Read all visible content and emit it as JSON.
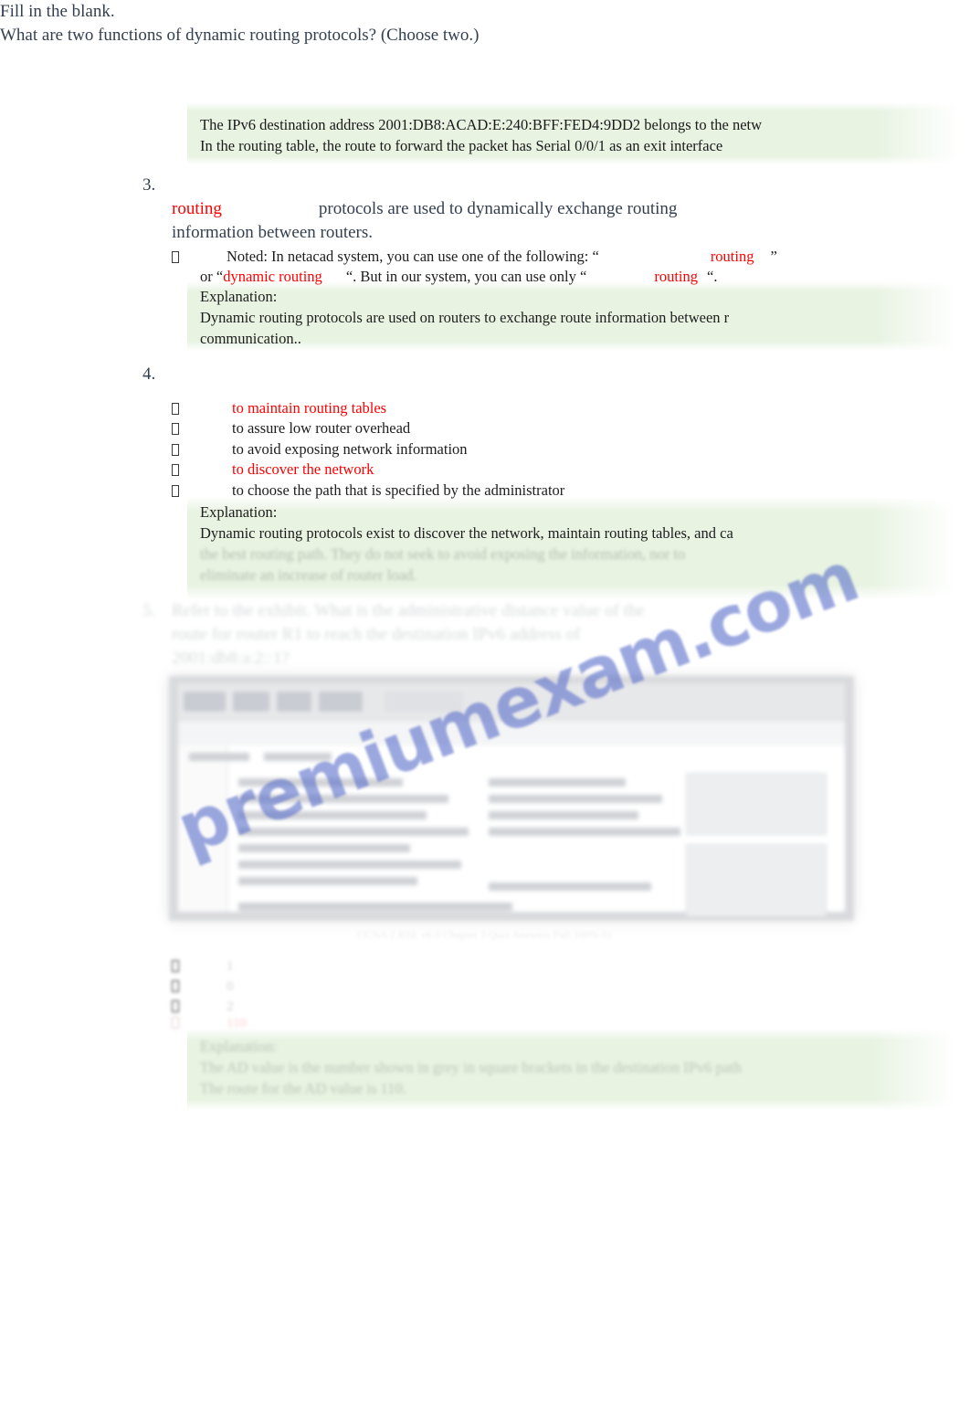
{
  "document": {
    "type": "exam-answer-key",
    "watermark": "premiumexam.com",
    "accent_red": "#ff0000",
    "highlight_green": "#e8f3e2",
    "heading_color": "#333f4f"
  },
  "top_block": {
    "lines": [
      "The IPv6 destination address 2001:DB8:ACAD:E:240:BFF:FED4:9DD2 belongs to the netw",
      "In the routing table, the route to forward the packet has Serial 0/0/1 as an exit interface"
    ]
  },
  "question3": {
    "number": "3.",
    "prompt": "Fill in the blank.",
    "answer_blank": "routing",
    "statement_part1": "protocols are used to dynamically exchange routing",
    "statement_part2": "information between routers.",
    "note": {
      "bullet": "tofu-box",
      "text_before": "Noted: In netacad system, you can use one of the following: “",
      "answer1": "routing",
      "text_mid1": "”",
      "text_or": "or “",
      "answer2": "dynamic routing",
      "text_mid2": "“. But in our system, you can use only “",
      "answer3": "routing",
      "text_end": "“."
    },
    "explanation": {
      "label": "Explanation:",
      "lines": [
        "Dynamic routing protocols are used on routers to exchange route information between r",
        "communication.."
      ]
    }
  },
  "question4": {
    "number": "4.",
    "prompt": "What are two functions of dynamic routing protocols? (Choose two.)",
    "options": [
      {
        "label": "to maintain routing tables",
        "correct": true
      },
      {
        "label": "to assure low router overhead",
        "correct": false
      },
      {
        "label": "to avoid exposing network information",
        "correct": false
      },
      {
        "label": "to discover the network",
        "correct": true
      },
      {
        "label": "to choose the path that is specified by the administrator",
        "correct": false
      }
    ],
    "explanation": {
      "label": "Explanation:",
      "lines": [
        "Dynamic routing protocols exist to discover the network, maintain routing tables, and ca",
        "the best routing path. They do not seek to avoid exposing the information, nor to",
        "eliminate an increase of router load."
      ]
    }
  },
  "question5": {
    "number": "5.",
    "prompt_lines": [
      "Refer to the exhibit. What is the administrative distance value of the",
      "route for router R1 to reach the destination IPv6 address of",
      "2001:db8:a:2::1?"
    ],
    "figure": {
      "caption": "CCNA 2 RSE v6.0 Chapter 3 Quiz Answers Full 100% 01",
      "watermark": "premiumexam.com"
    },
    "options": [
      {
        "label": "1",
        "correct": false
      },
      {
        "label": "0",
        "correct": false
      },
      {
        "label": "2",
        "correct": false
      },
      {
        "label": "110",
        "correct": true
      }
    ],
    "explanation": {
      "label": "Explanation:",
      "lines": [
        "The AD value is the number shown in grey in square brackets in the destination IPv6 path",
        "The route for the AD value is 110."
      ]
    }
  }
}
